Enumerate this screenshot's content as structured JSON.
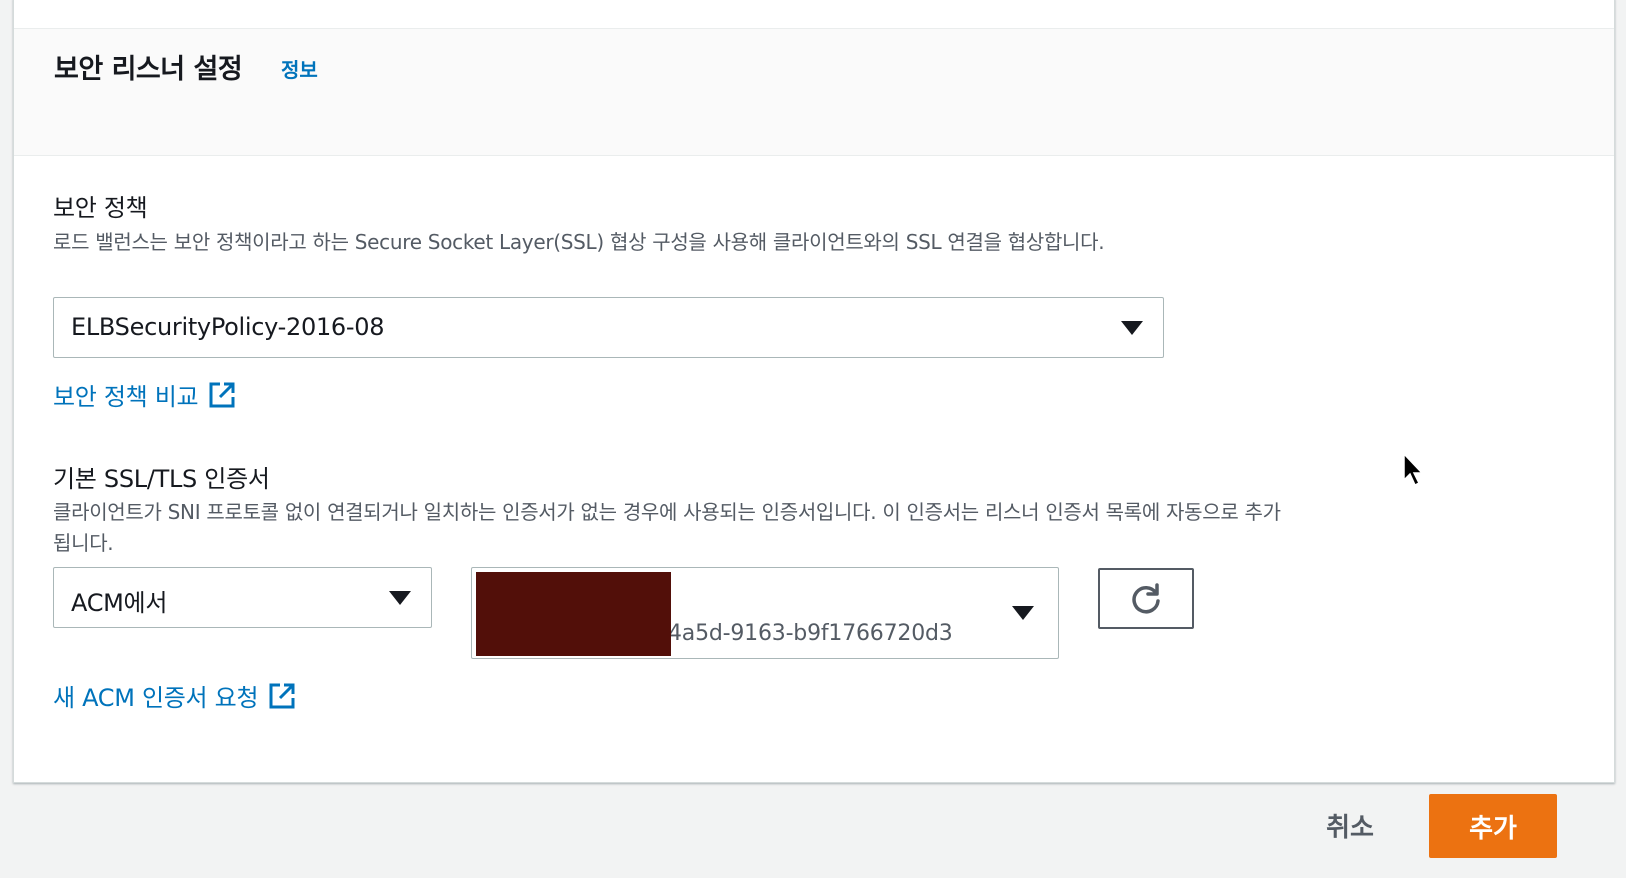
{
  "section": {
    "title": "보안 리스너 설정",
    "info_link": "정보"
  },
  "security_policy": {
    "label": "보안 정책",
    "description": "로드 밸런스는 보안 정책이라고 하는 Secure Socket Layer(SSL) 협상 구성을 사용해 클라이언트와의 SSL 연결을 협상합니다.",
    "selected": "ELBSecurityPolicy-2016-08",
    "compare_link": "보안 정책 비교"
  },
  "certificate": {
    "label": "기본 SSL/TLS 인증서",
    "description": "클라이언트가 SNI 프로토콜 없이 연결되거나 일치하는 인증서가 없는 경우에 사용되는 인증서입니다. 이 인증서는 리스너 인증서 목록에 자동으로 추가됩니다.",
    "source_selected": "ACM에서",
    "cert_id_visible": "4a5d-9163-b9f1766720d3",
    "request_link": "새 ACM 인증서 요청"
  },
  "footer": {
    "cancel_label": "취소",
    "add_label": "추가"
  },
  "colors": {
    "link": "#0073bb",
    "primary_button": "#ec7211",
    "redaction": "#520f09"
  }
}
